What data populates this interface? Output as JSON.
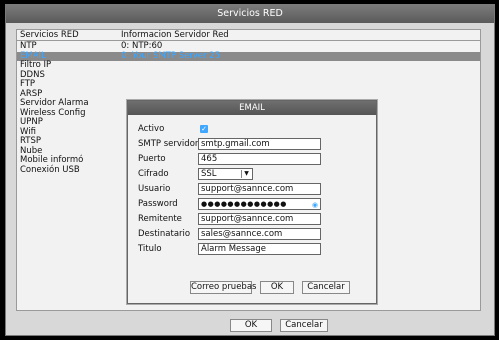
{
  "window": {
    "title": "Servicios RED"
  },
  "table": {
    "header": {
      "col1": "Servicios RED",
      "col2": "Informacion Servidor Red"
    },
    "rows": [
      {
        "name": "NTP",
        "info": "0: NTP:60"
      },
      {
        "name": "EMAIL",
        "info": "0: Your SMTP Server:25"
      },
      {
        "name": "Filtro IP",
        "info": ""
      },
      {
        "name": "DDNS",
        "info": ""
      },
      {
        "name": "FTP",
        "info": ""
      },
      {
        "name": "ARSP",
        "info": ""
      },
      {
        "name": "Servidor Alarma",
        "info": ""
      },
      {
        "name": "Wireless Config",
        "info": ""
      },
      {
        "name": "UPNP",
        "info": ""
      },
      {
        "name": "Wifi",
        "info": ""
      },
      {
        "name": "RTSP",
        "info": ""
      },
      {
        "name": "Nube",
        "info": ""
      },
      {
        "name": "Mobile informó",
        "info": ""
      },
      {
        "name": "Conexión USB",
        "info": ""
      }
    ]
  },
  "email_dialog": {
    "title": "EMAIL",
    "activo_label": "Activo",
    "activo_checked": true,
    "smtp_label": "SMTP servidor",
    "smtp_value": "smtp.gmail.com",
    "puerto_label": "Puerto",
    "puerto_value": "465",
    "cifrado_label": "Cifrado",
    "cifrado_value": "SSL",
    "usuario_label": "Usuario",
    "usuario_value": "support@sannce.com",
    "password_label": "Password",
    "password_value": "●●●●●●●●●●●●●",
    "remitente_label": "Remitente",
    "remitente_value": "support@sannce.com",
    "destinatario_label": "Destinatario",
    "destinatario_value": "sales@sannce.com",
    "titulo_label": "Titulo",
    "titulo_value": "Alarm Message",
    "test_button": "Correo pruebas",
    "ok_button": "OK",
    "cancel_button": "Cancelar"
  },
  "footer": {
    "ok_button": "OK",
    "cancel_button": "Cancelar"
  },
  "colors": {
    "accent": "#3fa7ff",
    "titlebar": "#666666",
    "selected_row": "#8a8a8a"
  }
}
